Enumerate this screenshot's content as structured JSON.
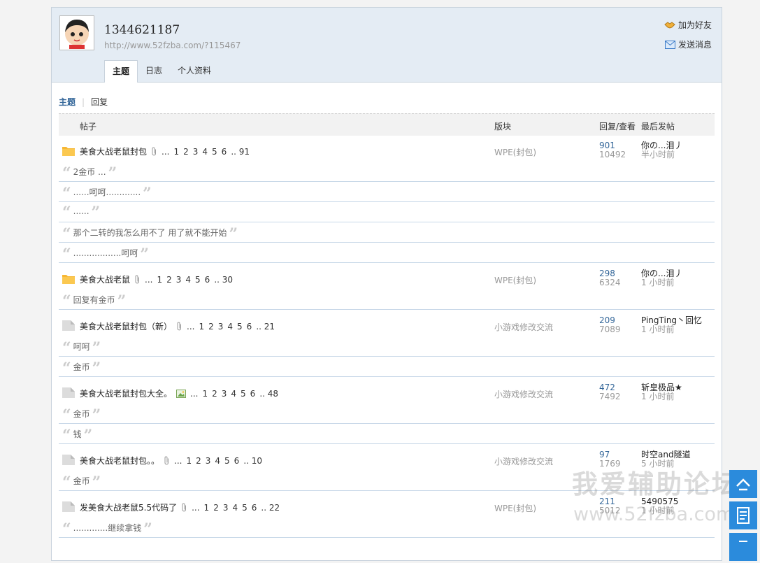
{
  "profile": {
    "username": "1344621187",
    "url": "http://www.52fzba.com/?115467",
    "add_friend": "加为好友",
    "send_message": "发送消息",
    "tabs": [
      "主题",
      "日志",
      "个人资料"
    ]
  },
  "subtabs": {
    "topics": "主题",
    "replies": "回复"
  },
  "table_header": {
    "thread": "帖子",
    "forum": "版块",
    "reply_view": "回复/查看",
    "last_post": "最后发帖"
  },
  "threads": [
    {
      "title": "美食大战老鼠封包",
      "pages": [
        "1",
        "2",
        "3",
        "4",
        "5",
        "6",
        ".. 91"
      ],
      "forum": "WPE(封包)",
      "replies": "901",
      "views": "10492",
      "last_user": "你の...泪丿",
      "last_time": "半小时前"
    },
    {
      "title": "美食大战老鼠",
      "pages": [
        "1",
        "2",
        "3",
        "4",
        "5",
        "6",
        ".. 30"
      ],
      "forum": "WPE(封包)",
      "replies": "298",
      "views": "6324",
      "last_user": "你の...泪丿",
      "last_time": "1 小时前"
    },
    {
      "title": "美食大战老鼠封包（新）",
      "pages": [
        "1",
        "2",
        "3",
        "4",
        "5",
        "6",
        ".. 21"
      ],
      "forum": "小游戏修改交流",
      "replies": "209",
      "views": "7089",
      "last_user": "PingTing丶回忆",
      "last_time": "1 小时前"
    },
    {
      "title": "美食大战老鼠封包大全。",
      "pages": [
        "1",
        "2",
        "3",
        "4",
        "5",
        "6",
        ".. 48"
      ],
      "forum": "小游戏修改交流",
      "replies": "472",
      "views": "7492",
      "last_user": "斩皇极品★",
      "last_time": "1 小时前"
    },
    {
      "title": "美食大战老鼠封包。。",
      "pages": [
        "1",
        "2",
        "3",
        "4",
        "5",
        "6",
        ".. 10"
      ],
      "forum": "小游戏修改交流",
      "replies": "97",
      "views": "1769",
      "last_user": "时空and隧道",
      "last_time": "5 小时前"
    },
    {
      "title": "发美食大战老鼠5.5代码了",
      "pages": [
        "1",
        "2",
        "3",
        "4",
        "5",
        "6",
        ".. 22"
      ],
      "forum": "WPE(封包)",
      "replies": "211",
      "views": "5012",
      "last_user": "5490575",
      "last_time": "1 小时前"
    }
  ],
  "quotes": [
    "2金币 ...",
    "......呵呵.............",
    "......",
    "那个二转的我怎么用不了 用了就不能开始",
    "..................呵呵",
    "回复有金币",
    "呵呵",
    "金币",
    "金币",
    "钱",
    "金币",
    ".............继续拿钱"
  ],
  "watermark": {
    "line1": "我爱辅助论坛",
    "line2": "www.52fzba.com"
  },
  "colors": {
    "link": "#336699",
    "header_bg": "#e4ecf4",
    "float_btn": "#2b8bdc",
    "folder_hot": "#f7b733"
  }
}
